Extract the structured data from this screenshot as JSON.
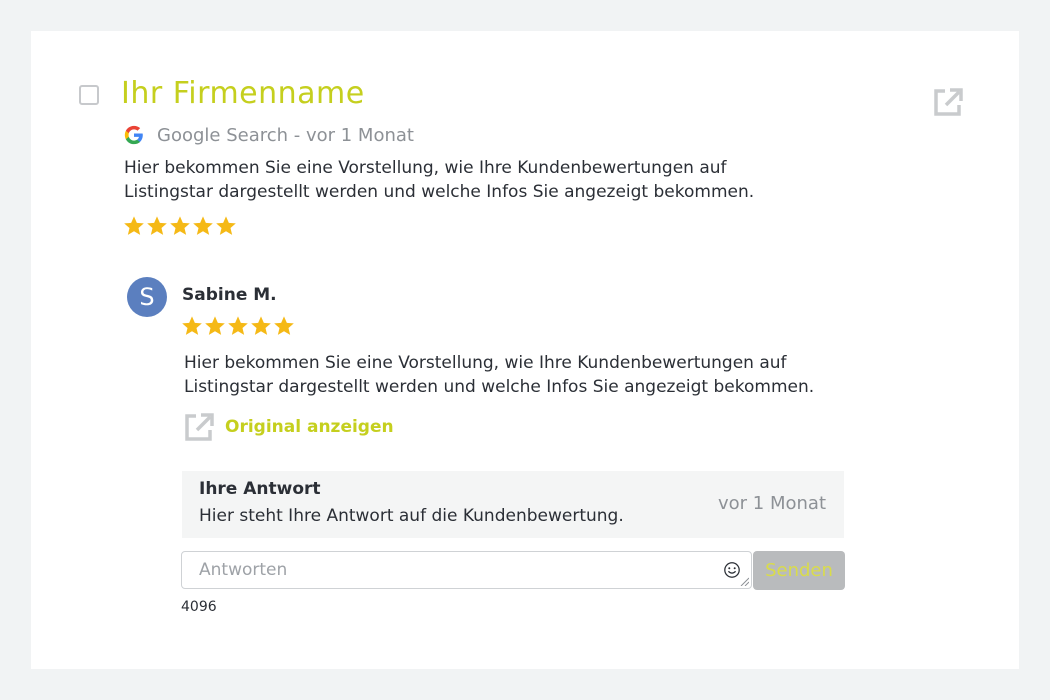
{
  "review": {
    "company_name": "Ihr Firmenname",
    "source_text": "Google Search - vor 1 Monat",
    "text": "Hier bekommen Sie eine Vorstellung, wie Ihre Kundenbewertungen auf Listingstar dargestellt werden und welche Infos Sie angezeigt bekommen.",
    "rating": 5
  },
  "author": {
    "initial": "S",
    "name": "Sabine M.",
    "rating": 5,
    "text": "Hier bekommen Sie eine Vorstellung, wie Ihre Kundenbewertungen auf Listingstar dargestellt werden und welche Infos Sie angezeigt bekommen.",
    "original_link_label": "Original anzeigen"
  },
  "answer": {
    "heading": "Ihre Antwort",
    "body": "Hier steht Ihre Antwort auf die Kundenbewertung.",
    "time": "vor 1 Monat"
  },
  "reply": {
    "placeholder": "Antworten",
    "send_label": "Senden",
    "char_counter": "4096"
  },
  "icons": {
    "select": "checkbox-icon",
    "open_external": "external-link-icon",
    "source": "google-icon",
    "star": "star-icon",
    "emoji": "emoji-icon"
  },
  "colors": {
    "accent": "#c5cf1e",
    "star": "#f5b916",
    "avatar": "#5b7fbf",
    "muted_text": "#8d9196"
  }
}
